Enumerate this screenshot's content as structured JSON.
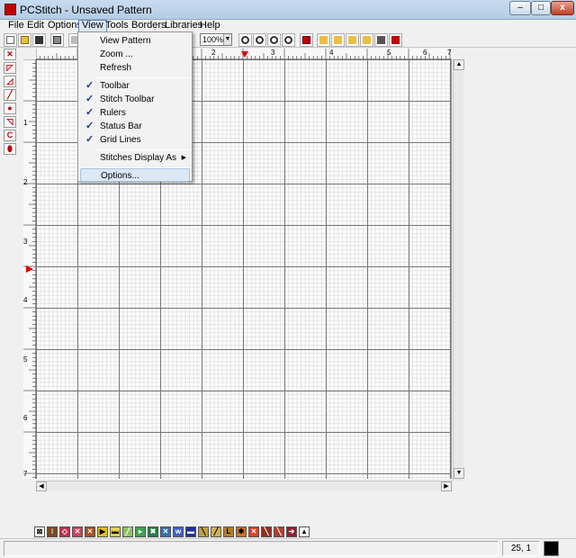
{
  "window": {
    "title": "PCStitch - Unsaved Pattern",
    "min_label": "–",
    "max_label": "□",
    "close_label": "x"
  },
  "menubar": {
    "items": [
      {
        "label": "File"
      },
      {
        "label": "Edit"
      },
      {
        "label": "Options"
      },
      {
        "label": "View"
      },
      {
        "label": "Tools"
      },
      {
        "label": "Borders"
      },
      {
        "label": "Libraries"
      },
      {
        "label": "Help"
      }
    ]
  },
  "toolbar": {
    "zoom_value": "100%"
  },
  "view_menu": {
    "items": [
      {
        "label": "View Pattern",
        "checked": false
      },
      {
        "label": "Zoom ...",
        "checked": false
      },
      {
        "label": "Refresh",
        "checked": false
      },
      {
        "label": "Toolbar",
        "checked": true
      },
      {
        "label": "Stitch Toolbar",
        "checked": true
      },
      {
        "label": "Rulers",
        "checked": true
      },
      {
        "label": "Status Bar",
        "checked": true
      },
      {
        "label": "Grid Lines",
        "checked": true
      },
      {
        "label": "Stitches Display As",
        "checked": false,
        "submenu": true
      },
      {
        "label": "Options...",
        "checked": false,
        "highlighted": true
      }
    ],
    "check_glyph": "✓",
    "submenu_glyph": "▶"
  },
  "rulers": {
    "top_numbers": [
      "2",
      "3",
      "4",
      "5",
      "6",
      "7"
    ],
    "left_numbers": [
      "1",
      "2",
      "3",
      "4",
      "5",
      "6",
      "7"
    ]
  },
  "left_toolbar": {
    "letter_c": "C"
  },
  "status": {
    "coord": "25, 1"
  },
  "colors": {
    "accent": "#c00000",
    "menu_highlight": "#dce8f6"
  }
}
